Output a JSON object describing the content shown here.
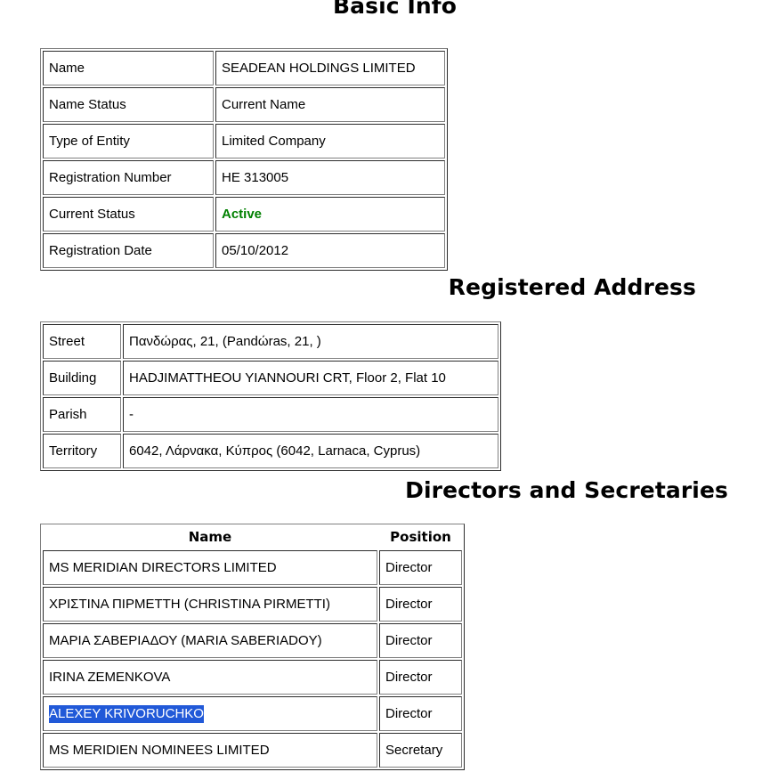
{
  "sections": {
    "basic_info": {
      "heading": "Basic Info",
      "rows": [
        {
          "label": "Name",
          "value": "SEADEAN HOLDINGS LIMITED",
          "style": "normal"
        },
        {
          "label": "Name Status",
          "value": "Current Name",
          "style": "normal"
        },
        {
          "label": "Type of Entity",
          "value": "Limited Company",
          "style": "normal"
        },
        {
          "label": "Registration Number",
          "value": "HE 313005",
          "style": "normal"
        },
        {
          "label": "Current Status",
          "value": "Active",
          "style": "active-green"
        },
        {
          "label": "Registration Date",
          "value": "05/10/2012",
          "style": "normal"
        }
      ]
    },
    "registered_address": {
      "heading": "Registered Address",
      "rows": [
        {
          "label": "Street",
          "value": "Πανδώρας, 21, (Pandώras, 21, )"
        },
        {
          "label": "Building",
          "value": "HADJIMATTHEOU YIANNOURI CRT, Floor 2, Flat 10"
        },
        {
          "label": "Parish",
          "value": "-"
        },
        {
          "label": "Territory",
          "value": "6042, Λάρνακα, Κύπρος (6042, Larnaca, Cyprus)"
        }
      ]
    },
    "directors_and_secretaries": {
      "heading": "Directors and Secretaries",
      "columns": {
        "name": "Name",
        "position": "Position"
      },
      "rows": [
        {
          "name": "MS MERIDIAN DIRECTORS LIMITED",
          "position": "Director",
          "selected": false
        },
        {
          "name": "ΧΡΙΣΤΙΝΑ ΠΙΡΜΕΤΤΗ (CHRISTINA PIRMETTI)",
          "position": "Director",
          "selected": false
        },
        {
          "name": "ΜΑΡΙΑ ΣΑΒΕΡΙΑΔΟΥ (MARIA SABERIADOY)",
          "position": "Director",
          "selected": false
        },
        {
          "name": "IRINA ZEMENKOVA",
          "position": "Director",
          "selected": false
        },
        {
          "name": "ALEXEY KRIVORUCHKO",
          "position": "Director",
          "selected": true
        },
        {
          "name": "MS MERIDIEN NOMINEES LIMITED",
          "position": "Secretary",
          "selected": false
        }
      ]
    }
  },
  "colors": {
    "status_active": "#008000",
    "selection_background": "#2159d8",
    "selection_text": "#ffffff",
    "table_border": "#808080",
    "page_background": "#ffffff",
    "text": "#000000"
  }
}
